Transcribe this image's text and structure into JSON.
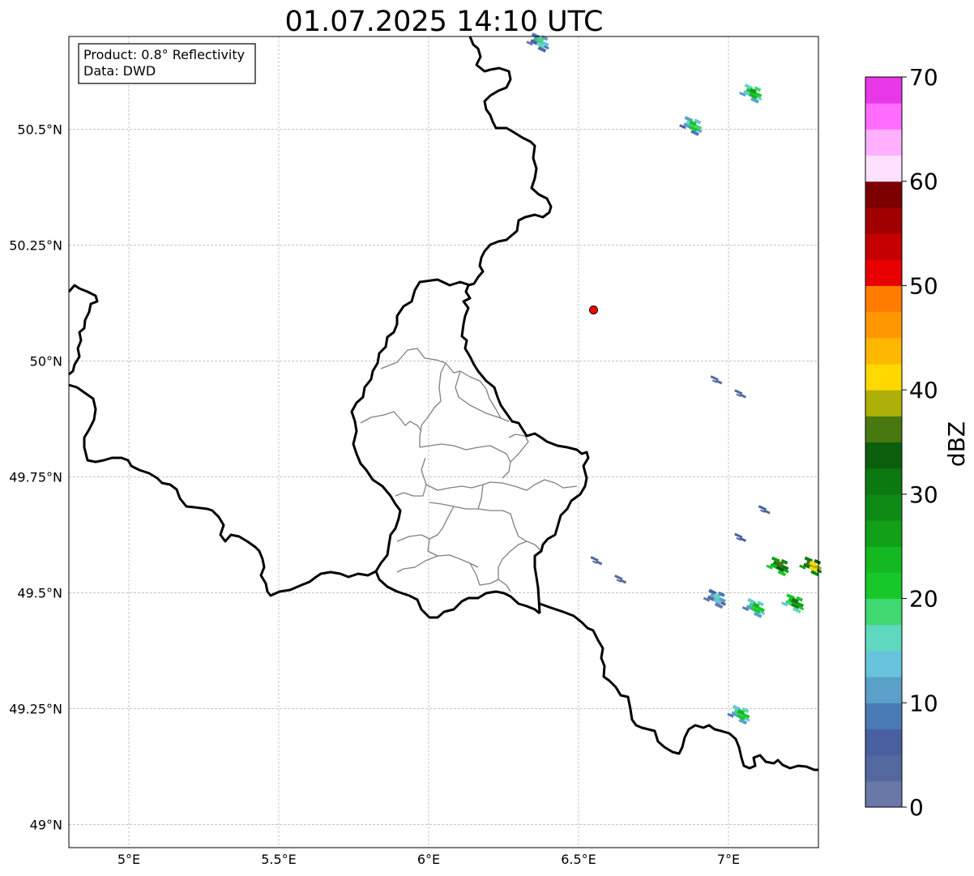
{
  "title": "01.07.2025 14:10 UTC",
  "info_box": {
    "product": "Product: 0.8° Reflectivity",
    "data": "Data: DWD"
  },
  "map": {
    "lon_range": [
      4.8,
      7.3
    ],
    "lat_range": [
      48.95,
      50.7
    ],
    "x_ticks": [
      {
        "value": 5.0,
        "label": "5°E"
      },
      {
        "value": 5.5,
        "label": "5.5°E"
      },
      {
        "value": 6.0,
        "label": "6°E"
      },
      {
        "value": 6.5,
        "label": "6.5°E"
      },
      {
        "value": 7.0,
        "label": "7°E"
      }
    ],
    "y_ticks": [
      {
        "value": 50.5,
        "label": "50.5°N"
      },
      {
        "value": 50.25,
        "label": "50.25°N"
      },
      {
        "value": 50.0,
        "label": "50°N"
      },
      {
        "value": 49.75,
        "label": "49.75°N"
      },
      {
        "value": 49.5,
        "label": "49.5°N"
      },
      {
        "value": 49.25,
        "label": "49.25°N"
      },
      {
        "value": 49.0,
        "label": "49°N"
      }
    ],
    "grid": true,
    "marker": {
      "lon": 6.55,
      "lat": 50.11,
      "color": "#ff0000"
    },
    "echoes": [
      {
        "lon": 6.37,
        "lat": 50.69,
        "dbz": 18
      },
      {
        "lon": 6.88,
        "lat": 50.51,
        "dbz": 22
      },
      {
        "lon": 7.08,
        "lat": 50.58,
        "dbz": 26
      },
      {
        "lon": 6.96,
        "lat": 49.96,
        "dbz": 4
      },
      {
        "lon": 7.04,
        "lat": 49.93,
        "dbz": 4
      },
      {
        "lon": 7.12,
        "lat": 49.68,
        "dbz": 6
      },
      {
        "lon": 7.04,
        "lat": 49.62,
        "dbz": 6
      },
      {
        "lon": 7.17,
        "lat": 49.56,
        "dbz": 36
      },
      {
        "lon": 7.28,
        "lat": 49.56,
        "dbz": 42
      },
      {
        "lon": 6.56,
        "lat": 49.57,
        "dbz": 4
      },
      {
        "lon": 6.64,
        "lat": 49.53,
        "dbz": 4
      },
      {
        "lon": 6.96,
        "lat": 49.49,
        "dbz": 16
      },
      {
        "lon": 7.09,
        "lat": 49.47,
        "dbz": 24
      },
      {
        "lon": 7.22,
        "lat": 49.48,
        "dbz": 30
      },
      {
        "lon": 7.04,
        "lat": 49.24,
        "dbz": 24
      }
    ]
  },
  "colorbar": {
    "label": "dBZ",
    "min": 0,
    "max": 70,
    "step": 2.5,
    "ticks": [
      {
        "value": 0,
        "label": "0"
      },
      {
        "value": 10,
        "label": "10"
      },
      {
        "value": 20,
        "label": "20"
      },
      {
        "value": 30,
        "label": "30"
      },
      {
        "value": 40,
        "label": "40"
      },
      {
        "value": 50,
        "label": "50"
      },
      {
        "value": 60,
        "label": "60"
      },
      {
        "value": 70,
        "label": "70"
      }
    ],
    "colors": [
      "#6a78a8",
      "#5468a0",
      "#4860a0",
      "#4a7ab4",
      "#5aa0c8",
      "#68c4dc",
      "#60d8c0",
      "#40d870",
      "#18c828",
      "#14b820",
      "#12a018",
      "#0e8a14",
      "#0c7810",
      "#0a5e0c",
      "#487810",
      "#acb008",
      "#ffd800",
      "#ffb800",
      "#ff9800",
      "#ff7c00",
      "#e80000",
      "#c40000",
      "#a00000",
      "#7c0000",
      "#ffe0ff",
      "#ffb0ff",
      "#ff6cff",
      "#e838e8"
    ]
  }
}
